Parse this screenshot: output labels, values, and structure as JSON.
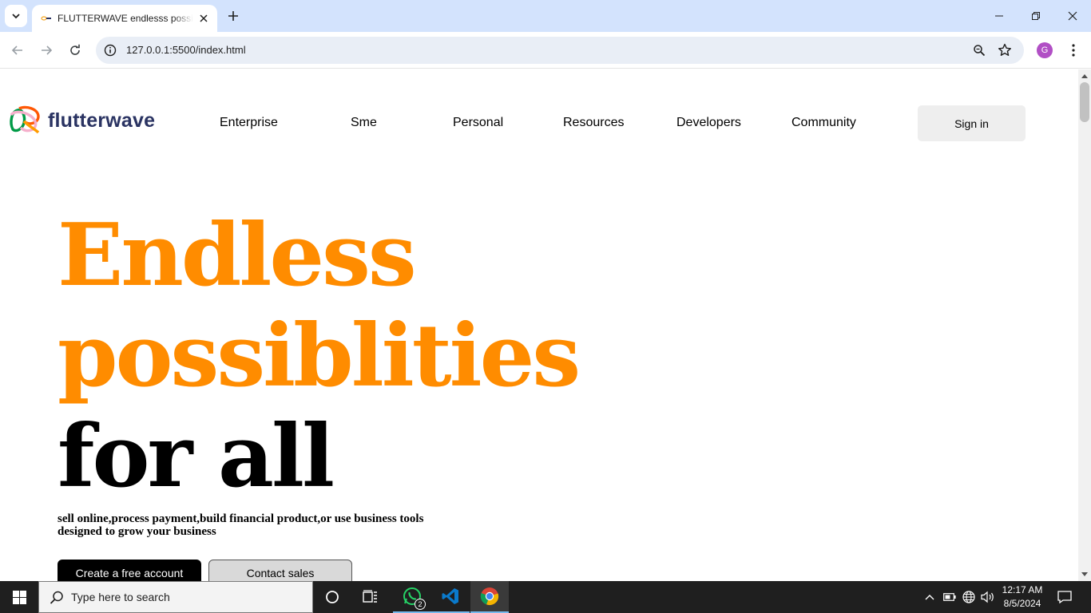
{
  "browser": {
    "tab_title": "FLUTTERWAVE endlesss possiblities",
    "url": "127.0.0.1:5500/index.html",
    "profile_initial": "G"
  },
  "page": {
    "logo_text": "flutterwave",
    "nav": [
      {
        "label": "Enterprise"
      },
      {
        "label": "Sme"
      },
      {
        "label": "Personal"
      },
      {
        "label": "Resources"
      },
      {
        "label": "Developers"
      },
      {
        "label": "Community"
      }
    ],
    "signin_label": "Sign in",
    "hero": {
      "line1": "Endless",
      "line2": "possiblities",
      "line3": "for all"
    },
    "subtitle": "sell online,process payment,build financial product,or use business tools designed to grow your business",
    "primary_cta": "Create a free account",
    "secondary_cta": "Contact sales"
  },
  "taskbar": {
    "search_placeholder": "Type here to search",
    "whatsapp_badge": "2",
    "time": "12:17 AM",
    "date": "8/5/2024"
  },
  "colors": {
    "accent_orange": "#ff8c00",
    "logo_text": "#2a3362",
    "tabbar": "#d3e3fd"
  }
}
